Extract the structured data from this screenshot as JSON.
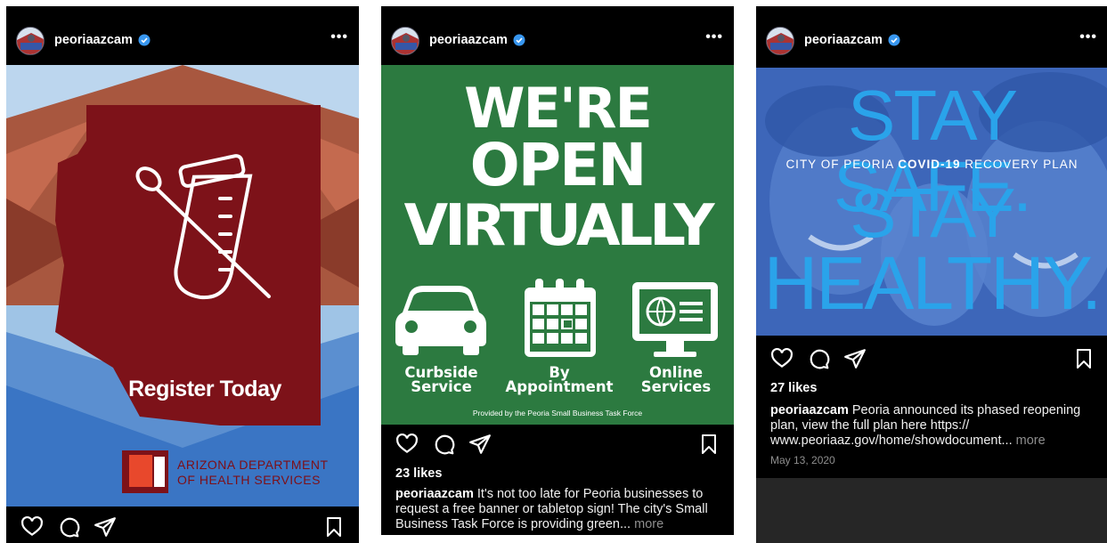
{
  "posts": [
    {
      "username": "peoriaazcam",
      "more_label": "•••",
      "image": {
        "headline": "Register Today",
        "logo_lines": [
          "ARIZONA DEPARTMENT",
          "OF HEALTH SERVICES"
        ]
      }
    },
    {
      "username": "peoriaazcam",
      "more_label": "•••",
      "image": {
        "headline_lines": [
          "WE'RE",
          "OPEN",
          "VIRTUALLY"
        ],
        "services": [
          {
            "line1": "Curbside",
            "line2": "Service"
          },
          {
            "line1": "By",
            "line2": "Appointment"
          },
          {
            "line1": "Online",
            "line2": "Services"
          }
        ],
        "footer": "Provided by the Peoria Small Business Task Force"
      },
      "likes": "23 likes",
      "caption_user": "peoriaazcam",
      "caption_text": " It's not too late for Peoria businesses to request a free banner or tabletop sign! The city's Small Business Task Force is providing green...",
      "caption_more": " more"
    },
    {
      "username": "peoriaazcam",
      "more_label": "•••",
      "image": {
        "line1": "STAY SAFE.",
        "subline_pre": "CITY OF PEORIA ",
        "subline_bold": "COVID-19",
        "subline_post": " RECOVERY PLAN",
        "line2": "STAY",
        "line3": "HEALTHY."
      },
      "likes": "27 likes",
      "caption_user": "peoriaazcam",
      "caption_text": " Peoria announced its phased reopening plan, view the full plan here https:// www.peoriaaz.gov/home/showdocument...",
      "caption_more": " more",
      "date": "May 13, 2020"
    }
  ],
  "colors": {
    "verified": "#3897f0",
    "card2_green": "#2c7a40",
    "arizona_red": "#7d0f17",
    "stay_blue": "#2aa3ea"
  },
  "icons": [
    "verified-badge-icon",
    "more-options-icon",
    "heart-icon",
    "comment-icon",
    "share-icon",
    "bookmark-icon"
  ]
}
